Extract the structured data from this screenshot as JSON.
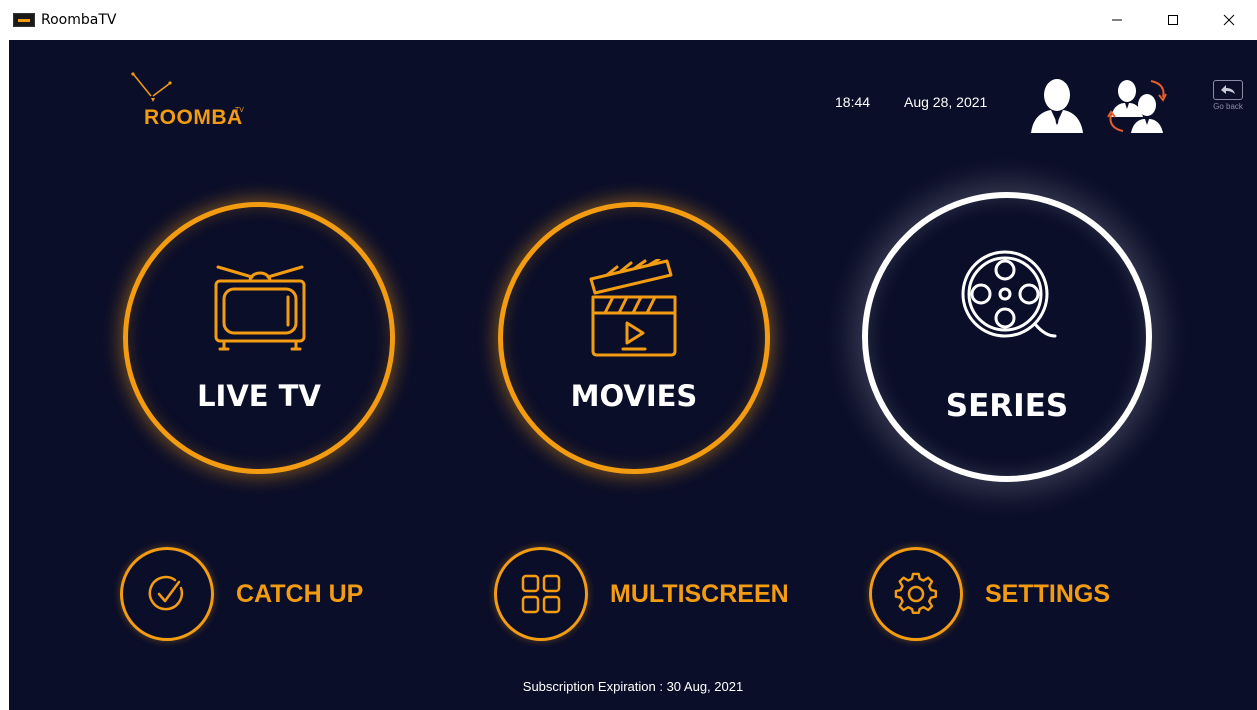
{
  "window": {
    "title": "RoombaTV"
  },
  "header": {
    "logo_text": "ROOMBA",
    "logo_tm": "TV",
    "time": "18:44",
    "date": "Aug 28, 2021",
    "go_back_label": "Go back"
  },
  "main_menu": [
    {
      "label": "LIVE TV",
      "icon": "tv-icon",
      "state": "normal"
    },
    {
      "label": "MOVIES",
      "icon": "clapperboard-icon",
      "state": "normal"
    },
    {
      "label": "SERIES",
      "icon": "film-reel-icon",
      "state": "selected"
    }
  ],
  "secondary_menu": [
    {
      "label": "CATCH UP",
      "icon": "check-circle-icon"
    },
    {
      "label": "MULTISCREEN",
      "icon": "grid-icon"
    },
    {
      "label": "SETTINGS",
      "icon": "gear-icon"
    }
  ],
  "footer": {
    "subscription": "Subscription Expiration : 30 Aug, 2021"
  },
  "colors": {
    "background": "#0b0e29",
    "accent": "#f39c12",
    "selected": "#ffffff"
  }
}
